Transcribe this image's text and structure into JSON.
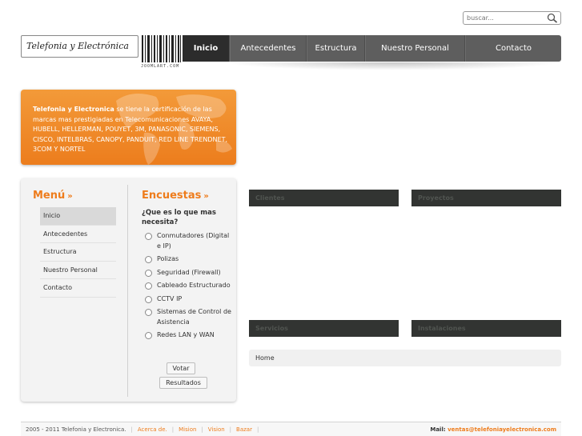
{
  "search": {
    "placeholder": "buscar..."
  },
  "logo": {
    "text": "Telefonia y Electrónica",
    "barcode_caption": "JOOMLART.COM"
  },
  "nav": {
    "items": [
      {
        "label": "Inicio",
        "active": true
      },
      {
        "label": "Antecedentes"
      },
      {
        "label": "Estructura"
      },
      {
        "label": "Nuestro Personal"
      },
      {
        "label": "Contacto"
      }
    ]
  },
  "banner": {
    "bold": "Telefonia y Electronica",
    "text": " se tiene la certificación de las marcas mas prestigiadas en Telecomunicaciones AVAYA, HUBELL, HELLERMAN, POUYET, 3M, PANASONIC, SIEMENS, CISCO, INTELBRAS, CANOPY, PANDUIT, RED LINE TRENDNET, 3COM Y NORTEL"
  },
  "menu": {
    "title": "Menú",
    "arrows": "»",
    "items": [
      "Inicio",
      "Antecedentes",
      "Estructura",
      "Nuestro Personal",
      "Contacto"
    ]
  },
  "poll": {
    "title": "Encuestas",
    "arrows": "»",
    "question": "¿Que es lo que mas necesita?",
    "options": [
      "Conmutadores (Digital e IP)",
      "Polizas",
      "Seguridad (Firewall)",
      "Cableado Estructurado",
      "CCTV IP",
      "Sistemas de Control de Asistencia",
      "Redes LAN y WAN"
    ],
    "vote_label": "Votar",
    "results_label": "Resultados"
  },
  "panels": [
    "Clientes",
    "Proyectos",
    "Servicios",
    "Instalaciones"
  ],
  "breadcrumb": "Home",
  "footer": {
    "copyright": "2005 - 2011 Telefonia y Electronica.",
    "links": [
      "Acerca de.",
      "Mision",
      "Vision",
      "Bazar"
    ],
    "mail_label": "Mail:",
    "mail": "ventas@telefoniayelectronica.com"
  },
  "colors": {
    "accent": "#ee7c1c",
    "nav_bg": "#5e5e5e",
    "nav_active": "#2c2c2c",
    "panel_bar": "#323432"
  }
}
